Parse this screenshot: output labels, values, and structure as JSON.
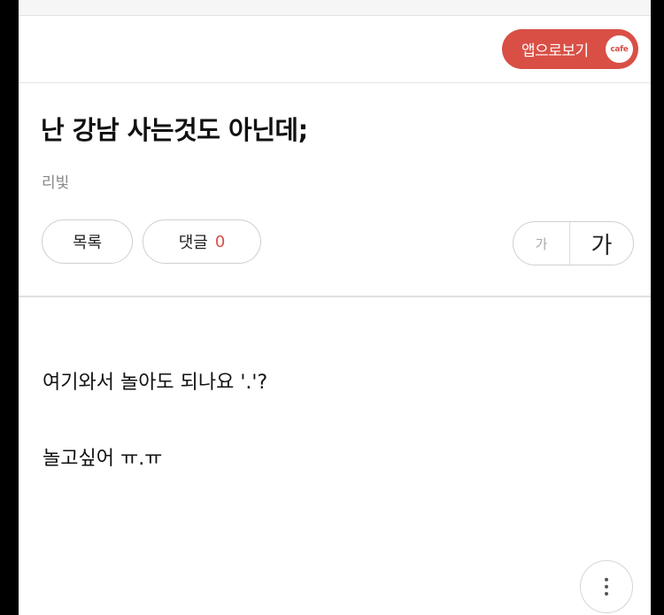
{
  "app_button": {
    "label": "앱으로보기",
    "icon_text": "cafe"
  },
  "post": {
    "title": "난 강남 사는것도 아닌데;",
    "author": "리빛",
    "body": [
      "여기와서 놀아도 되나요 '.'?",
      "놀고싶어 ㅠ.ㅠ"
    ]
  },
  "actions": {
    "list_label": "목록",
    "comment_label": "댓글",
    "comment_count": "0",
    "font_small": "가",
    "font_large": "가"
  },
  "colors": {
    "accent": "#d94f45"
  },
  "icons": {
    "more": "more-vertical-icon",
    "cafe": "cafe-icon"
  }
}
